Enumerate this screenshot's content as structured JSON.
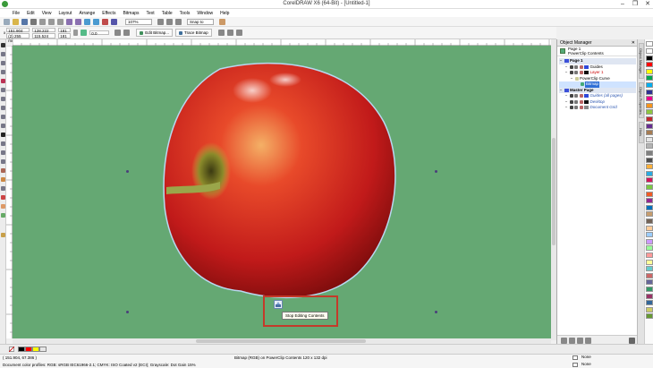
{
  "window": {
    "title": "CorelDRAW X6 (64-Bit) - [Untitled-1]",
    "minimize": "–",
    "restore": "❐",
    "close": "✕"
  },
  "menu": [
    "File",
    "Edit",
    "View",
    "Layout",
    "Arrange",
    "Effects",
    "Bitmaps",
    "Text",
    "Table",
    "Tools",
    "Window",
    "Help"
  ],
  "standard_toolbar": {
    "zoom": "107%",
    "snap_to": "Snap to"
  },
  "property_bar": {
    "x": "151.904 mm",
    "y": "(2) 255 mm",
    "width": "128.222 mm",
    "height": "115.524 mm",
    "scale_w": "181 %",
    "scale_h": "181 %",
    "rotation": "0.0",
    "edit_bitmap": "Edit Bitmap...",
    "trace_bitmap": "Trace Bitmap"
  },
  "object_manager": {
    "title": "Object Manager",
    "page_label": "Page 1",
    "layer_label": "PowerClip Contents",
    "tree": [
      {
        "label": "Page 1",
        "bold": true,
        "indent": 0,
        "swatch": "#3b4fd8"
      },
      {
        "label": "Guides",
        "bold": false,
        "indent": 1,
        "swatch": "#2f48d9"
      },
      {
        "label": "Layer 1",
        "bold": false,
        "indent": 1,
        "swatch": "#111",
        "red": true
      },
      {
        "label": "PowerClip Curve",
        "bold": false,
        "indent": 2,
        "swatch": ""
      },
      {
        "label": "Bitmap",
        "bold": false,
        "indent": 3,
        "swatch": "",
        "selected": true
      },
      {
        "label": "Master Page",
        "bold": true,
        "indent": 0,
        "swatch": "#3b4fd8"
      },
      {
        "label": "Guides (all pages)",
        "bold": false,
        "indent": 1,
        "swatch": "#2f48d9",
        "italic": true
      },
      {
        "label": "Desktop",
        "bold": false,
        "indent": 1,
        "swatch": "#111",
        "italic": true
      },
      {
        "label": "Document Grid",
        "bold": false,
        "indent": 1,
        "swatch": "#888",
        "italic": true
      }
    ]
  },
  "docker_tabs": [
    "Object Manager",
    "Object Properties",
    "Hints"
  ],
  "tooltip": "Stop Editing Contents",
  "status": {
    "coords": "( 151.904, 67.386 )",
    "object_info": "Bitmap (RGB) on PowerClip Contents 120 x 132 dpi",
    "color_profiles": "Document color profiles: RGB: sRGB IEC61966-2.1; CMYK: ISO Coated v2 (ECI); Grayscale: Dot Gain 15%",
    "fill_none": "None",
    "outline_none": "None"
  },
  "palette_colors": [
    "#ffffff",
    "#000000",
    "#ff0000",
    "#ffff00",
    "#00a651",
    "#00aeef",
    "#2e3192",
    "#ec008c",
    "#f7941d",
    "#8dc63f",
    "#c1272d",
    "#662d91",
    "#a67c52",
    "#e6e6e6",
    "#b3b3b3",
    "#808080",
    "#4d4d4d",
    "#fbb03b",
    "#29abe2",
    "#d4145a",
    "#7ac943",
    "#f15a24",
    "#93278f",
    "#0071bc",
    "#c69c6d",
    "#736357",
    "#ffcc99",
    "#99ccff",
    "#cc99ff",
    "#99ff99",
    "#ff9999",
    "#ffff99",
    "#66cccc",
    "#cc6666",
    "#666699",
    "#339966",
    "#993366",
    "#336699",
    "#cccc66",
    "#669933"
  ],
  "page_swatches": [
    "#000000",
    "#ff0000",
    "#ffff00",
    "#e6e6e6"
  ]
}
